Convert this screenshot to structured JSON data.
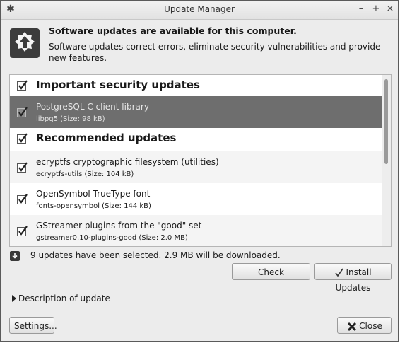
{
  "window": {
    "title": "Update Manager"
  },
  "header": {
    "title": "Software updates are available for this computer.",
    "description": "Software updates correct errors, eliminate security vulnerabilities and provide new features."
  },
  "groups": [
    {
      "label": "Important security updates",
      "checked": true,
      "items": [
        {
          "name": "PostgreSQL C client library",
          "detail": "libpq5 (Size: 98 kB)",
          "checked": true,
          "selected": true
        }
      ]
    },
    {
      "label": "Recommended updates",
      "checked": true,
      "items": [
        {
          "name": "ecryptfs cryptographic filesystem (utilities)",
          "detail": "ecryptfs-utils (Size: 104 kB)",
          "checked": true
        },
        {
          "name": "OpenSymbol TrueType font",
          "detail": "fonts-opensymbol (Size: 144 kB)",
          "checked": true
        },
        {
          "name": "GStreamer plugins from the \"good\" set",
          "detail": "gstreamer0.10-plugins-good (Size: 2.0 MB)",
          "checked": true
        }
      ]
    }
  ],
  "status": {
    "text": "9 updates have been selected. 2.9 MB will be downloaded."
  },
  "buttons": {
    "check": "Check",
    "install": "Install Updates",
    "settings": "Settings...",
    "close": "Close"
  },
  "description_toggle": {
    "label": "Description of update",
    "expanded": false
  }
}
